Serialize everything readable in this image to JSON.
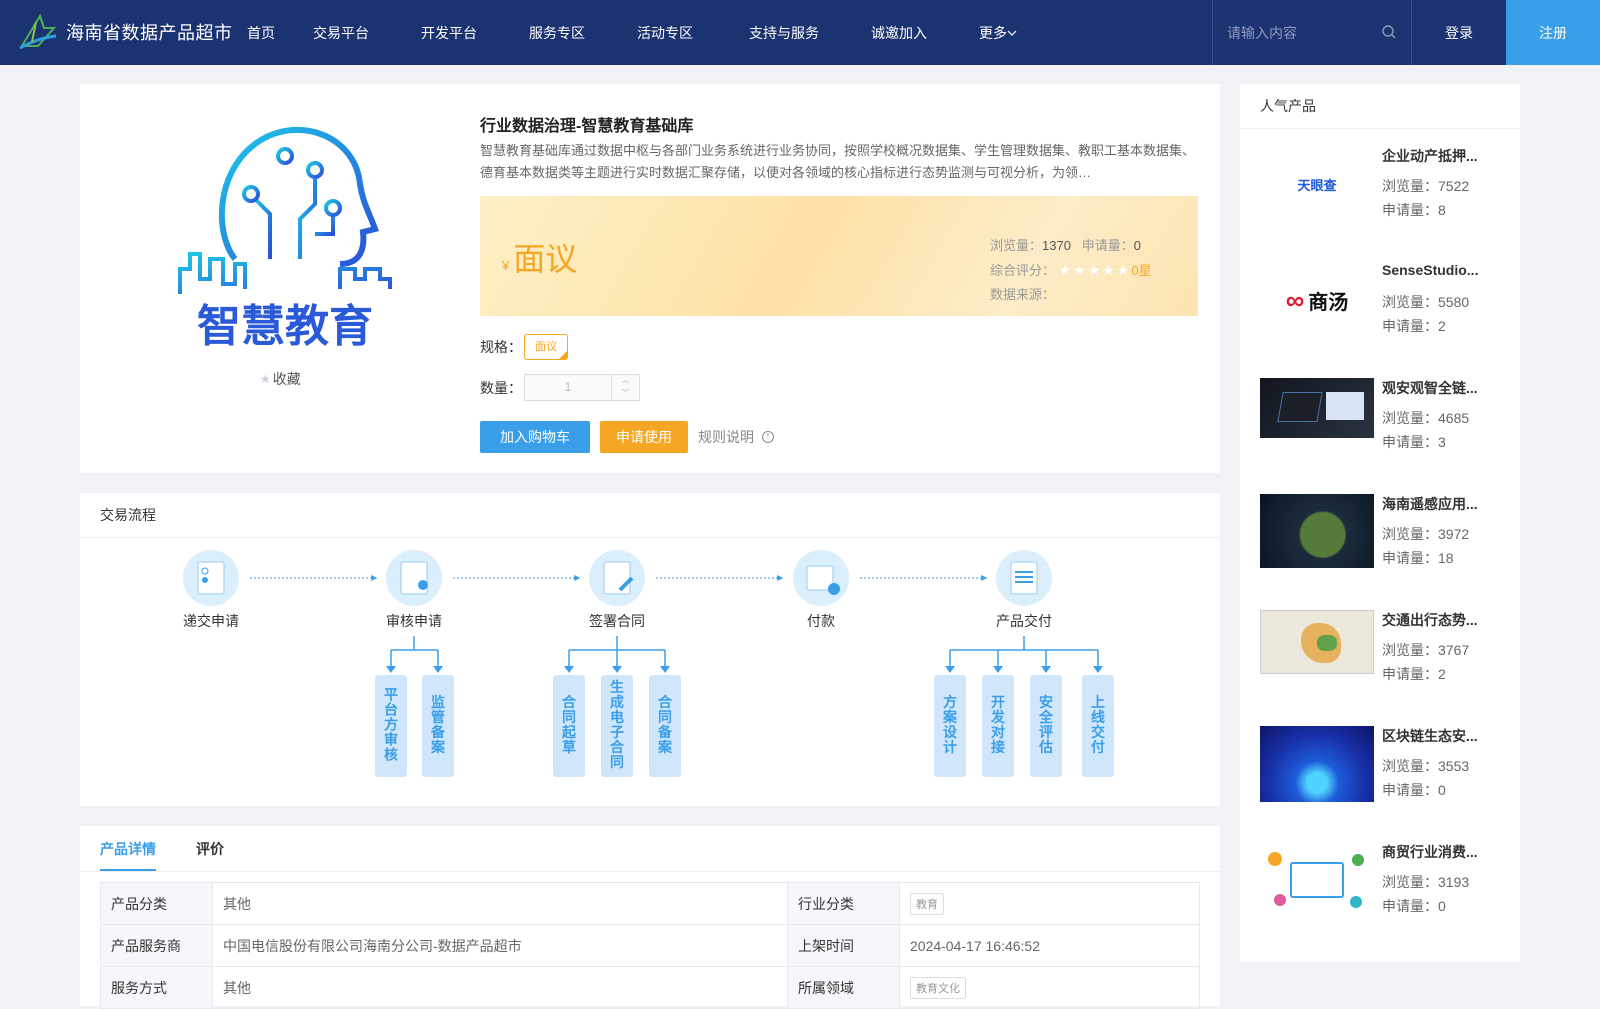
{
  "header": {
    "site_name": "海南省数据产品超市",
    "nav": [
      "首页",
      "交易平台",
      "开发平台",
      "服务专区",
      "活动专区",
      "支持与服务",
      "诚邀加入",
      "更多"
    ],
    "search_placeholder": "请输入内容",
    "login": "登录",
    "register": "注册"
  },
  "product": {
    "image_text": "智慧教育",
    "favorite": "收藏",
    "title": "行业数据治理-智慧教育基础库",
    "description": "智慧教育基础库通过数据中枢与各部门业务系统进行业务协同，按照学校概况数据集、学生管理数据集、教职工基本数据集、德育基本数据类等主题进行实时数据汇聚存储，以便对各领域的核心指标进行态势监测与可视分析，为领…",
    "currency": "¥",
    "price": "面议",
    "views_label": "浏览量：",
    "views": "1370",
    "apply_label": "申请量：",
    "apply": "0",
    "rating_label": "综合评分：",
    "stars": "★★★★★",
    "rating": "0星",
    "source_label": "数据来源：",
    "spec_label": "规格：",
    "spec_value": "面议",
    "qty_label": "数量：",
    "qty_value": "1",
    "add_cart": "加入购物车",
    "apply_use": "申请使用",
    "rules": "规则说明"
  },
  "flow": {
    "title": "交易流程",
    "steps": [
      "递交申请",
      "审核申请",
      "签署合同",
      "付款",
      "产品交付"
    ],
    "sub_review": [
      "平台方审核",
      "监管备案"
    ],
    "sub_contract": [
      "合同起草",
      "生成电子合同",
      "合同备案"
    ],
    "sub_delivery": [
      "方案设计",
      "开发对接",
      "安全评估",
      "上线交付"
    ]
  },
  "detail": {
    "tabs": [
      "产品详情",
      "评价"
    ],
    "rows": [
      {
        "k1": "产品分类",
        "v1": "其他",
        "k2": "行业分类",
        "v2": "教育"
      },
      {
        "k1": "产品服务商",
        "v1": "中国电信股份有限公司海南分公司-数据产品超市",
        "k2": "上架时间",
        "v2": "2024-04-17 16:46:52"
      },
      {
        "k1": "服务方式",
        "v1": "其他",
        "k2": "所属领域",
        "v2": "教育文化"
      }
    ]
  },
  "popular": {
    "title": "人气产品",
    "views_label": "浏览量：",
    "apply_label": "申请量：",
    "items": [
      {
        "name": "企业动产抵押...",
        "views": "7522",
        "apply": "8",
        "logo": "天眼查"
      },
      {
        "name": "SenseStudio...",
        "views": "5580",
        "apply": "2",
        "logo": "商汤"
      },
      {
        "name": "观安观智全链...",
        "views": "4685",
        "apply": "3",
        "logo": ""
      },
      {
        "name": "海南遥感应用...",
        "views": "3972",
        "apply": "18",
        "logo": ""
      },
      {
        "name": "交通出行态势...",
        "views": "3767",
        "apply": "2",
        "logo": ""
      },
      {
        "name": "区块链生态安...",
        "views": "3553",
        "apply": "0",
        "logo": ""
      },
      {
        "name": "商贸行业消费...",
        "views": "3193",
        "apply": "0",
        "logo": ""
      }
    ]
  },
  "colors": {
    "header": "#1c3372",
    "accent": "#3a9ee8",
    "orange": "#f5a623"
  }
}
